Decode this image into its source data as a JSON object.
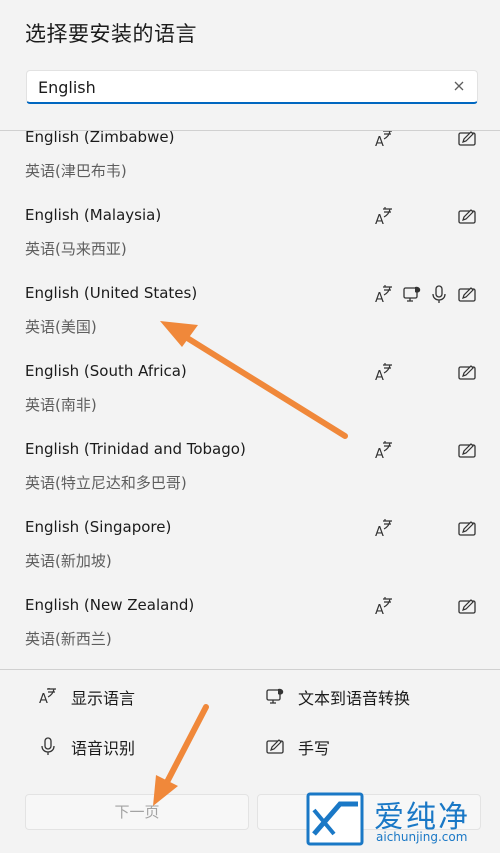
{
  "title": "选择要安装的语言",
  "search": {
    "value": "English"
  },
  "languages": [
    {
      "name": "English (Zimbabwe)",
      "local": "英语(津巴布韦)",
      "features": [
        "display-language",
        "handwriting"
      ]
    },
    {
      "name": "English (Malaysia)",
      "local": "英语(马来西亚)",
      "features": [
        "display-language",
        "handwriting"
      ]
    },
    {
      "name": "English (United States)",
      "local": "英语(美国)",
      "features": [
        "display-language",
        "text-to-speech",
        "speech-recognition",
        "handwriting"
      ]
    },
    {
      "name": "English (South Africa)",
      "local": "英语(南非)",
      "features": [
        "display-language",
        "handwriting"
      ]
    },
    {
      "name": "English (Trinidad and Tobago)",
      "local": "英语(特立尼达和多巴哥)",
      "features": [
        "display-language",
        "handwriting"
      ]
    },
    {
      "name": "English (Singapore)",
      "local": "英语(新加坡)",
      "features": [
        "display-language",
        "handwriting"
      ]
    },
    {
      "name": "English (New Zealand)",
      "local": "英语(新西兰)",
      "features": [
        "display-language",
        "handwriting"
      ]
    }
  ],
  "legend": {
    "display": "显示语言",
    "tts": "文本到语音转换",
    "speech": "语音识别",
    "handwriting": "手写"
  },
  "buttons": {
    "next": "下一页"
  },
  "watermark": {
    "text": "爱纯净",
    "url": "aichunjing.com"
  },
  "colors": {
    "accent": "#0067c0",
    "arrow": "#f0883a",
    "watermark": "#1a78c6"
  }
}
